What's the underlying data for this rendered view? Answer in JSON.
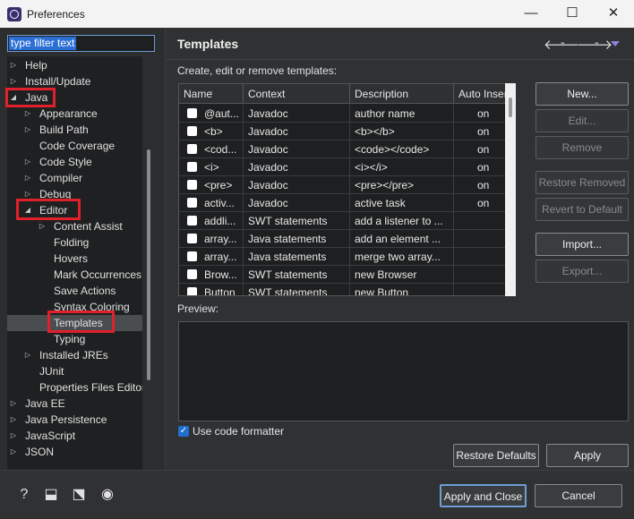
{
  "window": {
    "title": "Preferences",
    "min_glyph": "—",
    "max_glyph": "☐",
    "close_glyph": "✕"
  },
  "filter": {
    "value": "type filter text"
  },
  "tree": {
    "items": [
      {
        "label": "Help",
        "expander": "▷"
      },
      {
        "label": "Install/Update",
        "expander": "▷"
      },
      {
        "label": "Java",
        "expander": "◢"
      },
      {
        "label": "Appearance",
        "expander": "▷"
      },
      {
        "label": "Build Path",
        "expander": "▷"
      },
      {
        "label": "Code Coverage",
        "expander": ""
      },
      {
        "label": "Code Style",
        "expander": "▷"
      },
      {
        "label": "Compiler",
        "expander": "▷"
      },
      {
        "label": "Debug",
        "expander": "▷"
      },
      {
        "label": "Editor",
        "expander": "◢"
      },
      {
        "label": "Content Assist",
        "expander": "▷"
      },
      {
        "label": "Folding",
        "expander": ""
      },
      {
        "label": "Hovers",
        "expander": ""
      },
      {
        "label": "Mark Occurrences",
        "expander": ""
      },
      {
        "label": "Save Actions",
        "expander": ""
      },
      {
        "label": "Syntax Coloring",
        "expander": ""
      },
      {
        "label": "Templates",
        "expander": ""
      },
      {
        "label": "Typing",
        "expander": ""
      },
      {
        "label": "Installed JREs",
        "expander": "▷"
      },
      {
        "label": "JUnit",
        "expander": ""
      },
      {
        "label": "Properties Files Editor",
        "expander": ""
      },
      {
        "label": "Java EE",
        "expander": "▷"
      },
      {
        "label": "Java Persistence",
        "expander": "▷"
      },
      {
        "label": "JavaScript",
        "expander": "▷"
      },
      {
        "label": "JSON",
        "expander": "▷"
      }
    ]
  },
  "page": {
    "title": "Templates",
    "caption": "Create, edit or remove templates:",
    "nav": {
      "back": "🡐",
      "forward": "🡒",
      "dropdown": "▾"
    }
  },
  "table": {
    "headers": {
      "name": "Name",
      "context": "Context",
      "description": "Description",
      "auto_insert": "Auto Insert",
      "sort": "⌄"
    },
    "rows": [
      {
        "name": "@aut...",
        "context": "Javadoc",
        "description": "author name",
        "auto": "on"
      },
      {
        "name": "<b>",
        "context": "Javadoc",
        "description": "<b></b>",
        "auto": "on"
      },
      {
        "name": "<cod...",
        "context": "Javadoc",
        "description": "<code></code>",
        "auto": "on"
      },
      {
        "name": "<i>",
        "context": "Javadoc",
        "description": "<i></i>",
        "auto": "on"
      },
      {
        "name": "<pre>",
        "context": "Javadoc",
        "description": "<pre></pre>",
        "auto": "on"
      },
      {
        "name": "activ...",
        "context": "Javadoc",
        "description": "active task",
        "auto": "on"
      },
      {
        "name": "addli...",
        "context": "SWT statements",
        "description": "add a listener to ...",
        "auto": ""
      },
      {
        "name": "array...",
        "context": "Java statements",
        "description": "add an element ...",
        "auto": ""
      },
      {
        "name": "array...",
        "context": "Java statements",
        "description": "merge two array...",
        "auto": ""
      },
      {
        "name": "Brow...",
        "context": "SWT statements",
        "description": "new Browser",
        "auto": ""
      },
      {
        "name": "Button",
        "context": "SWT statements",
        "description": "new Button",
        "auto": ""
      }
    ]
  },
  "buttons": {
    "new": "New...",
    "edit": "Edit...",
    "remove": "Remove",
    "restore_removed": "Restore Removed",
    "revert_default": "Revert to Default",
    "import": "Import...",
    "export": "Export...",
    "restore_defaults": "Restore Defaults",
    "apply": "Apply",
    "apply_close": "Apply and Close",
    "cancel": "Cancel"
  },
  "preview": {
    "label": "Preview:"
  },
  "formatter": {
    "label": "Use code formatter",
    "checked": true,
    "check_glyph": "✓"
  },
  "footer_icons": {
    "help": "?",
    "import_prefs": "⬓",
    "export_prefs": "⬔",
    "oomph": "◉"
  },
  "colors": {
    "highlight": "#e0202a",
    "accent": "#6f9dd6",
    "selection": "#2a6fd6"
  }
}
